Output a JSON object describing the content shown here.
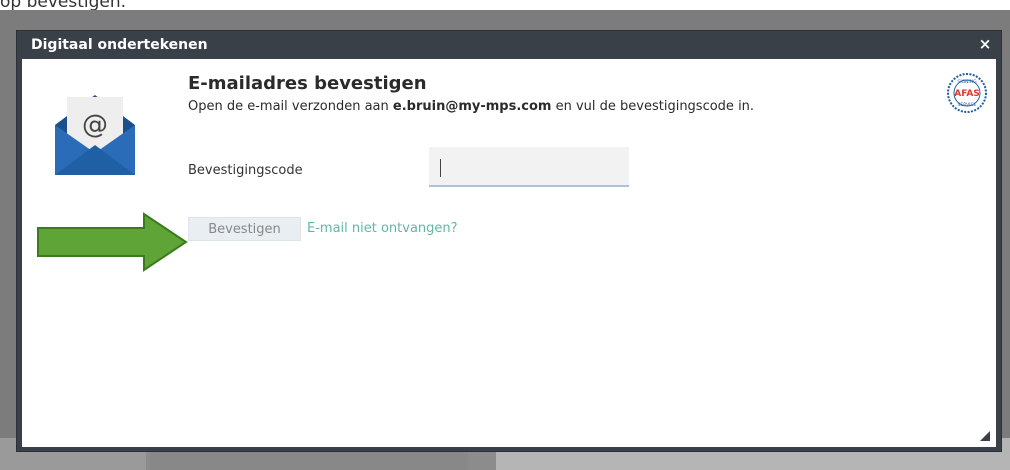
{
  "page": {
    "caption_partial": "op bevestigen."
  },
  "dialog": {
    "title": "Digitaal ondertekenen",
    "close_label": "×",
    "heading": "E-mailadres bevestigen",
    "desc_before": "Open de e-mail verzonden aan ",
    "email": "e.bruin@my-mps.com",
    "desc_after": " en vul de bevestigingscode in.",
    "code_label": "Bevestigingscode",
    "code_value": "",
    "confirm_label": "Bevestigen",
    "resend_label": "E-mail niet ontvangen?",
    "badge": {
      "top_text": "SIGNING",
      "brand": "AFAS",
      "bottom_text": "SERVICE"
    }
  },
  "icons": {
    "envelope": "envelope-at-icon",
    "arrow": "green-arrow-icon",
    "close": "close-icon",
    "resize": "resize-grip-icon"
  },
  "colors": {
    "titlebar": "#3a4048",
    "envelope": "#1f5fa6",
    "arrow": "#5ea436",
    "link": "#5fb8a6",
    "button_bg": "#e9eef3"
  }
}
